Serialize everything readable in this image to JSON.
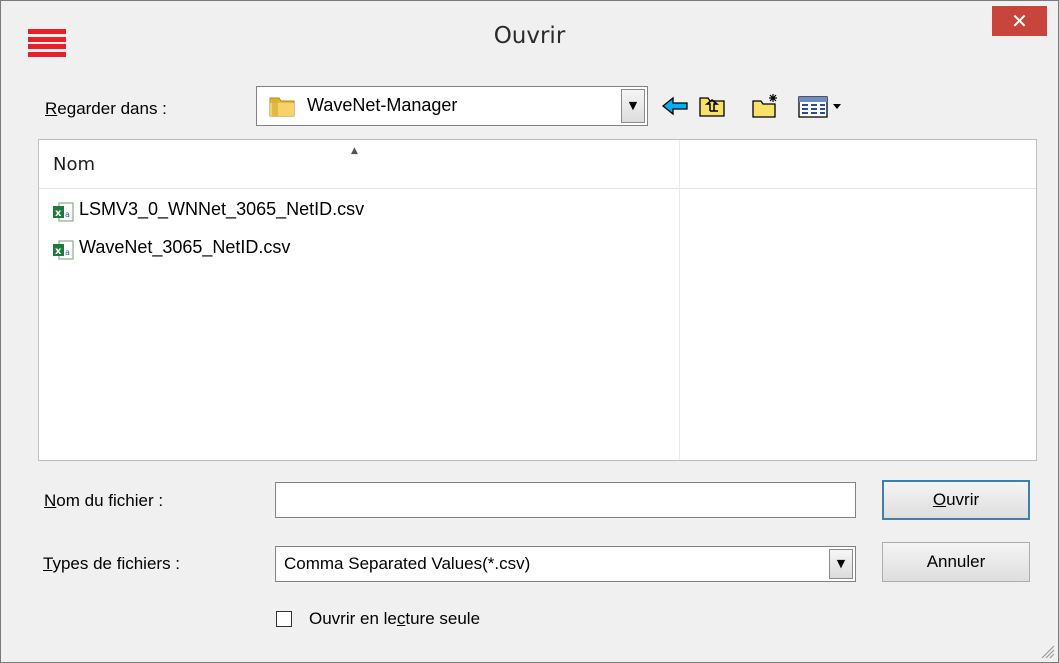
{
  "window": {
    "title": "Ouvrir",
    "close_glyph": "✕",
    "app_icon": "hamburger-menu-icon"
  },
  "lookin": {
    "label_underlined": "R",
    "label_rest": "egarder dans :",
    "folder_name": "WaveNet-Manager",
    "folder_icon": "folder-icon",
    "toolbar_icons": [
      "back-arrow-icon",
      "up-folder-icon",
      "new-folder-icon",
      "view-menu-icon"
    ]
  },
  "filelist": {
    "column_name": "Nom",
    "files": [
      {
        "name": "LSMV3_0_WNNet_3065_NetID.csv",
        "icon": "excel-csv-icon"
      },
      {
        "name": "WaveNet_3065_NetID.csv",
        "icon": "excel-csv-icon"
      }
    ]
  },
  "filename": {
    "label_underlined": "N",
    "label_rest": "om du fichier :",
    "value": ""
  },
  "filetype": {
    "label_underlined": "T",
    "label_rest": "ypes de fichiers :",
    "selected": "Comma Separated Values(*.csv)"
  },
  "buttons": {
    "open_underlined": "O",
    "open_rest": "uvrir",
    "cancel": "Annuler"
  },
  "readonly": {
    "label_before": "Ouvrir en le",
    "label_underlined": "c",
    "label_after": "ture seule",
    "checked": false
  },
  "colors": {
    "close_button": "#c7453a",
    "app_icon": "#e8202a",
    "back_arrow": "#00b0f0",
    "folder": "#f0c850"
  }
}
